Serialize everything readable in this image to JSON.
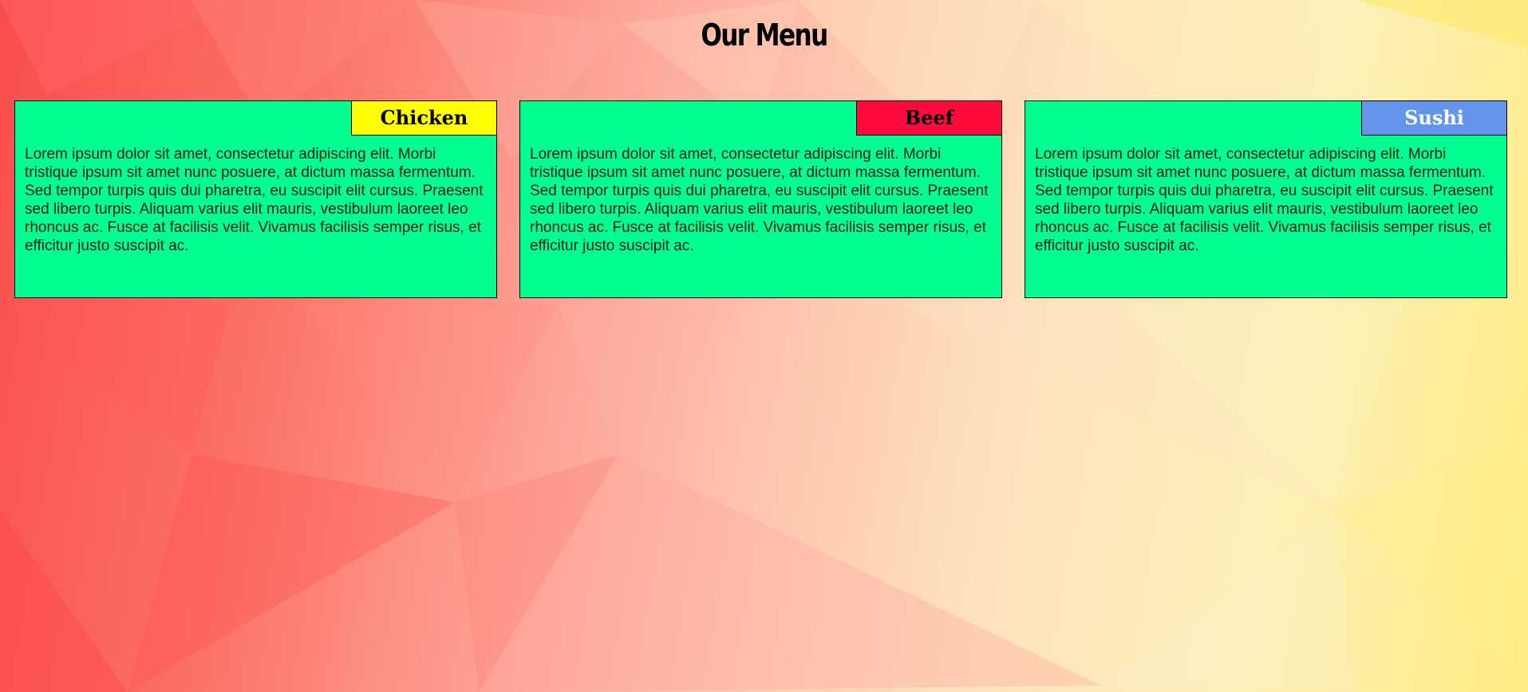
{
  "page": {
    "title": "Our Menu"
  },
  "menu_items": [
    {
      "label": "Chicken",
      "label_bg": "#ffff00",
      "label_color": "#000000",
      "description": "Lorem ipsum dolor sit amet, consectetur adipiscing elit. Morbi tristique ipsum sit amet nunc posuere, at dictum massa fermentum. Sed tempor turpis quis dui pharetra, eu suscipit elit cursus. Praesent sed libero turpis. Aliquam varius elit mauris, vestibulum laoreet leo rhoncus ac. Fusce at facilisis velit. Vivamus facilisis semper risus, et efficitur justo suscipit ac."
    },
    {
      "label": "Beef",
      "label_bg": "#ff0a3c",
      "label_color": "#000000",
      "description": "Lorem ipsum dolor sit amet, consectetur adipiscing elit. Morbi tristique ipsum sit amet nunc posuere, at dictum massa fermentum. Sed tempor turpis quis dui pharetra, eu suscipit elit cursus. Praesent sed libero turpis. Aliquam varius elit mauris, vestibulum laoreet leo rhoncus ac. Fusce at facilisis velit. Vivamus facilisis semper risus, et efficitur justo suscipit ac."
    },
    {
      "label": "Sushi",
      "label_bg": "#6495ed",
      "label_color": "#ffffff",
      "description": "Lorem ipsum dolor sit amet, consectetur adipiscing elit. Morbi tristique ipsum sit amet nunc posuere, at dictum massa fermentum. Sed tempor turpis quis dui pharetra, eu suscipit elit cursus. Praesent sed libero turpis. Aliquam varius elit mauris, vestibulum laoreet leo rhoncus ac. Fusce at facilisis velit. Vivamus facilisis semper risus, et efficitur justo suscipit ac."
    }
  ],
  "colors": {
    "card_bg": "#00ff90",
    "card_border": "#000000"
  }
}
